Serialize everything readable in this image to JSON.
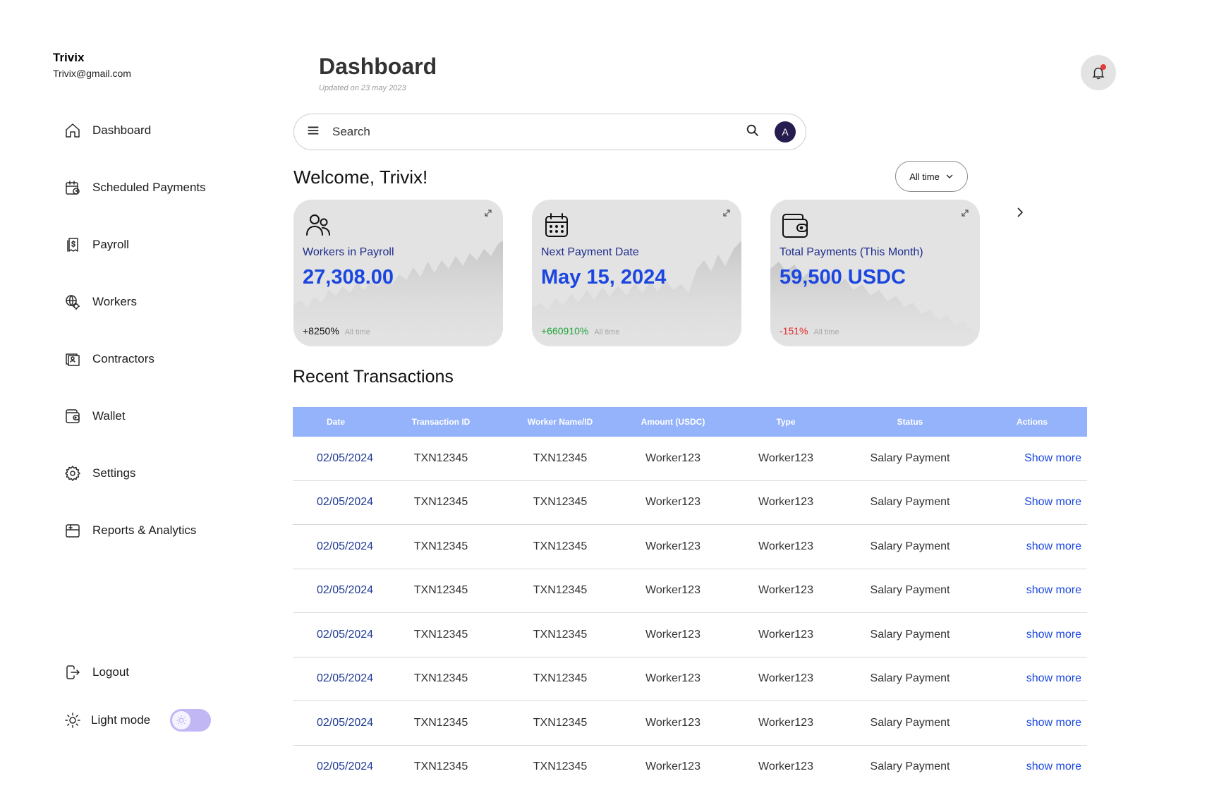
{
  "user": {
    "name": "Trivix",
    "email": "Trivix@gmail.com"
  },
  "sidebar": {
    "items": [
      {
        "label": "Dashboard",
        "icon": "home-icon"
      },
      {
        "label": "Scheduled Payments",
        "icon": "calendar-clock-icon"
      },
      {
        "label": "Payroll",
        "icon": "receipt-dollar-icon"
      },
      {
        "label": "Workers",
        "icon": "workers-globe-icon"
      },
      {
        "label": "Contractors",
        "icon": "contract-icon"
      },
      {
        "label": "Wallet",
        "icon": "wallet-icon"
      },
      {
        "label": "Settings",
        "icon": "gear-icon"
      },
      {
        "label": "Reports & Analytics",
        "icon": "report-icon"
      }
    ],
    "logout_label": "Logout",
    "theme_label": "Light mode",
    "theme_toggle_on": true
  },
  "header": {
    "title": "Dashboard",
    "updated": "Updated on 23 may 2023",
    "notification_dot_color": "#e43a3a"
  },
  "search": {
    "placeholder": "Search",
    "avatar_initial": "A"
  },
  "welcome": "Welcome, Trivix!",
  "range_filter": "All time",
  "stats": [
    {
      "title": "Workers in Payroll",
      "value": "27,308.00",
      "change": "+8250%",
      "period": "All time",
      "icon": "users-icon",
      "trend": "neutral"
    },
    {
      "title": "Next Payment Date",
      "value": "May 15, 2024",
      "change": "+660910%",
      "period": "All time",
      "icon": "calendar-icon",
      "trend": "up"
    },
    {
      "title": "Total Payments (This Month)",
      "value": "59,500 USDC",
      "change": "-151%",
      "period": "All time",
      "icon": "wallet-icon",
      "trend": "down"
    }
  ],
  "transactions": {
    "title": "Recent Transactions",
    "columns": [
      "Date",
      "Transaction ID",
      "Worker Name/ID",
      "Amount (USDC)",
      "Type",
      "Status",
      "Actions"
    ],
    "rows": [
      [
        "02/05/2024",
        "TXN12345",
        "TXN12345",
        "Worker123",
        "Worker123",
        "Salary Payment",
        "Show more"
      ],
      [
        "02/05/2024",
        "TXN12345",
        "TXN12345",
        "Worker123",
        "Worker123",
        "Salary Payment",
        "Show more"
      ],
      [
        "02/05/2024",
        "TXN12345",
        "TXN12345",
        "Worker123",
        "Worker123",
        "Salary Payment",
        "show more"
      ],
      [
        "02/05/2024",
        "TXN12345",
        "TXN12345",
        "Worker123",
        "Worker123",
        "Salary Payment",
        "show more"
      ],
      [
        "02/05/2024",
        "TXN12345",
        "TXN12345",
        "Worker123",
        "Worker123",
        "Salary Payment",
        "show more"
      ],
      [
        "02/05/2024",
        "TXN12345",
        "TXN12345",
        "Worker123",
        "Worker123",
        "Salary Payment",
        "show more"
      ],
      [
        "02/05/2024",
        "TXN12345",
        "TXN12345",
        "Worker123",
        "Worker123",
        "Salary Payment",
        "show more"
      ],
      [
        "02/05/2024",
        "TXN12345",
        "TXN12345",
        "Worker123",
        "Worker123",
        "Salary Payment",
        "show more"
      ]
    ]
  },
  "colors": {
    "accent_blue": "#1b47e0",
    "table_header": "#95b3fb",
    "toggle": "#c2b7f5",
    "positive": "#22a33b",
    "negative": "#e32a2a"
  }
}
